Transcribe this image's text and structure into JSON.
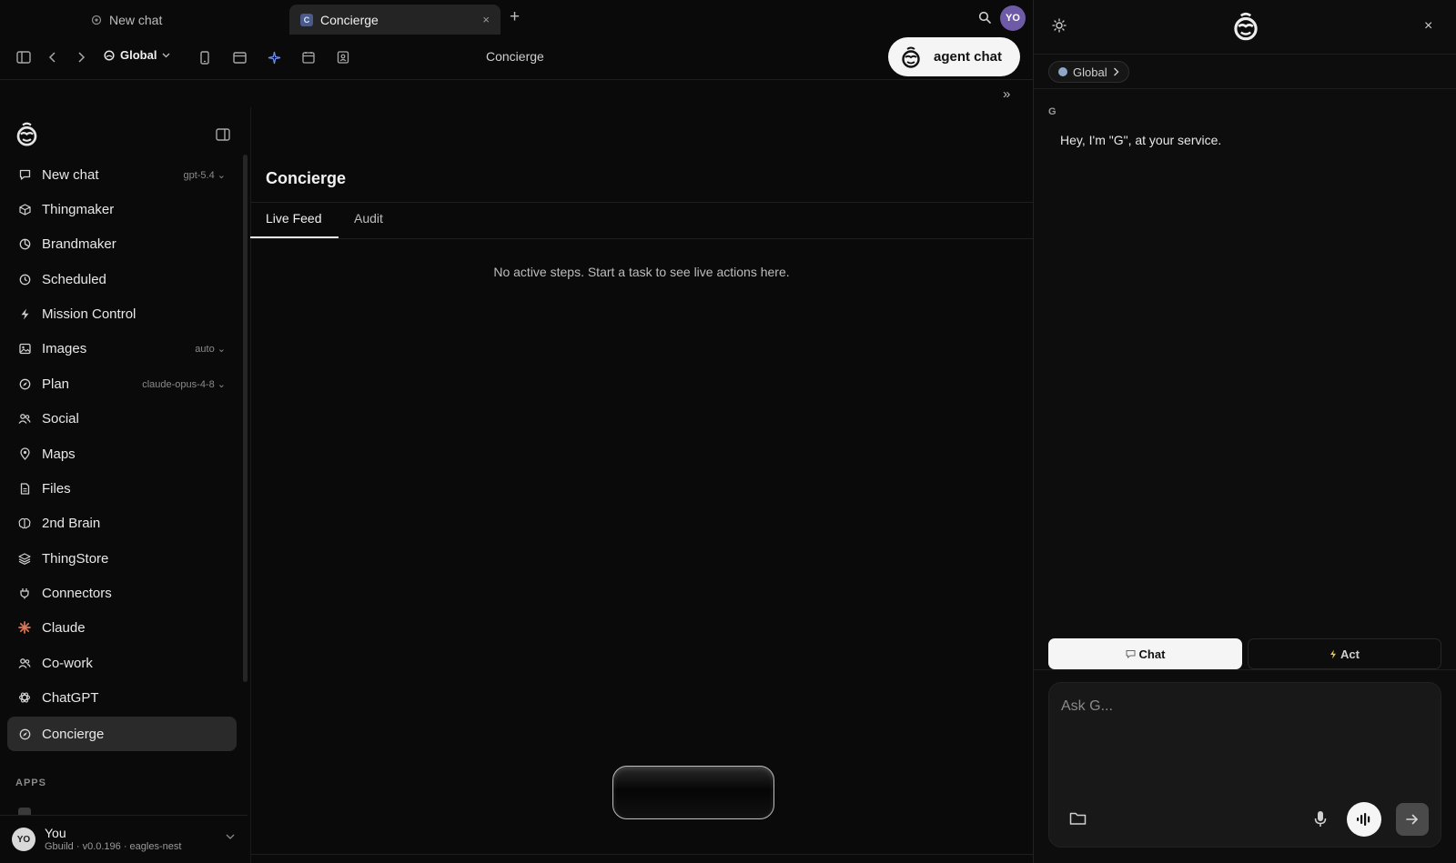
{
  "browser": {
    "tabs": [
      {
        "label": "New chat",
        "active": false
      },
      {
        "label": "Concierge",
        "active": true,
        "favicon_letter": "C"
      }
    ],
    "close_glyph": "×",
    "new_tab_glyph": "+",
    "user_initials": "YO"
  },
  "toolbar": {
    "workspace": "Global",
    "title": "Concierge",
    "agent_chat_label": "agent chat"
  },
  "sidebar": {
    "items": [
      {
        "label": "New chat",
        "icon": "chat-bubble-icon",
        "meta": "gpt-5.4"
      },
      {
        "label": "Thingmaker",
        "icon": "cube-icon",
        "meta": ""
      },
      {
        "label": "Brandmaker",
        "icon": "pie-icon",
        "meta": ""
      },
      {
        "label": "Scheduled",
        "icon": "clock-icon",
        "meta": ""
      },
      {
        "label": "Mission Control",
        "icon": "bolt-icon",
        "meta": ""
      },
      {
        "label": "Images",
        "icon": "image-icon",
        "meta": "auto"
      },
      {
        "label": "Plan",
        "icon": "compass-icon",
        "meta": "claude-opus-4-8"
      },
      {
        "label": "Social",
        "icon": "people-icon",
        "meta": ""
      },
      {
        "label": "Maps",
        "icon": "pin-icon",
        "meta": ""
      },
      {
        "label": "Files",
        "icon": "file-icon",
        "meta": ""
      },
      {
        "label": "2nd Brain",
        "icon": "brain-icon",
        "meta": ""
      },
      {
        "label": "ThingStore",
        "icon": "layers-icon",
        "meta": ""
      },
      {
        "label": "Connectors",
        "icon": "plug-icon",
        "meta": ""
      },
      {
        "label": "Claude",
        "icon": "claude-burst-icon",
        "meta": ""
      },
      {
        "label": "Co-work",
        "icon": "people-icon",
        "meta": ""
      },
      {
        "label": "ChatGPT",
        "icon": "openai-icon",
        "meta": ""
      },
      {
        "label": "Concierge",
        "icon": "compass-icon",
        "meta": "",
        "active": true
      }
    ],
    "apps_label": "APPS",
    "user": {
      "initials": "YO",
      "name": "You",
      "subtitle": "Gbuild · v0.0.196 · eagles-nest"
    }
  },
  "main": {
    "title": "Concierge",
    "tabs": [
      "Live Feed",
      "Audit"
    ],
    "active_tab": "Live Feed",
    "empty_message": "No active steps. Start a task to see live actions here.",
    "collapse_glyph": "»"
  },
  "assistant": {
    "workspace_chip": "Global",
    "sender": "G",
    "greeting": "Hey, I'm \"G\", at your service.",
    "modes": {
      "chat": "Chat",
      "act": "Act",
      "active": "chat"
    },
    "input_placeholder": "Ask G...",
    "close_glyph": "×"
  },
  "colors": {
    "accent": "#f5f5f5",
    "background": "#0a0a0a",
    "panel": "#0d0d0d",
    "active_item": "#2a2a2a"
  }
}
